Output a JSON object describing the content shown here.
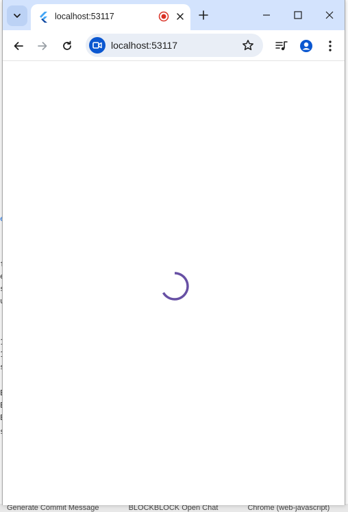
{
  "background_app": {
    "bottom_items": [
      "Generate Commit Message",
      "BLOCKBLOCK Open Chat",
      "Chrome (web-javascript)"
    ]
  },
  "tab": {
    "title": "localhost:53117",
    "favicon": "flutter-icon",
    "recording": true
  },
  "toolbar": {
    "url": "localhost:53117",
    "site_chip_icon": "video-camera-icon"
  },
  "page": {
    "state": "loading",
    "spinner_color": "#6750a4"
  },
  "colors": {
    "titlebar": "#d3e3fd",
    "omnibox": "#e9eef6",
    "accent": "#0b57d0",
    "record": "#d93025"
  }
}
